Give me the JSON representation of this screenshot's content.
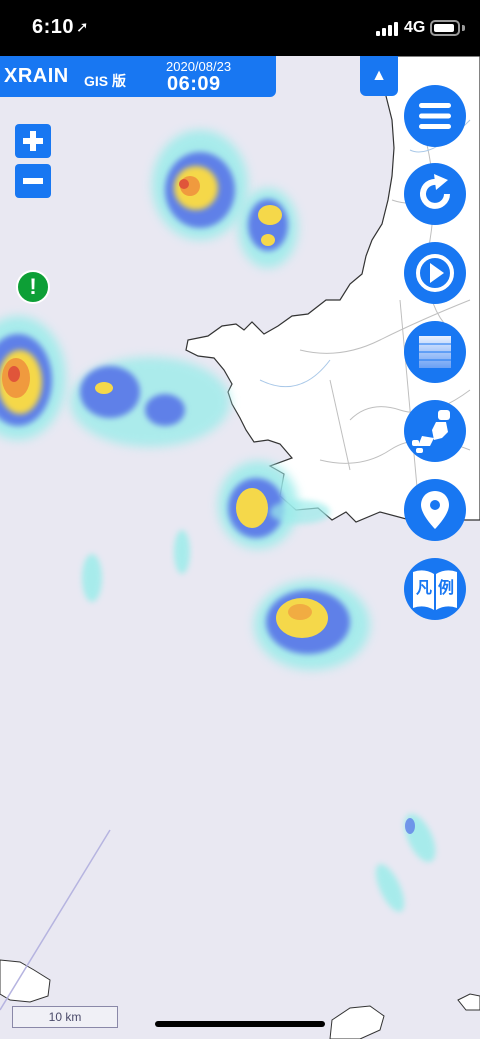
{
  "status_bar": {
    "time": "6:10",
    "location_icon": "location-arrow-icon",
    "network": "4G",
    "signal_icon": "cellular-signal-icon",
    "battery_icon": "battery-icon",
    "battery_level": 0.9
  },
  "header": {
    "title": "XRAIN",
    "subtitle": "GIS 版",
    "date": "2020/08/23",
    "time": "06:09"
  },
  "collapse_button": {
    "icon": "triangle-up-icon",
    "label": "▲"
  },
  "zoom": {
    "in_icon": "plus-icon",
    "out_icon": "minus-icon"
  },
  "alert": {
    "icon": "exclamation-icon",
    "label": "!",
    "color": "#0d9f36"
  },
  "side_buttons": [
    {
      "name": "menu-button",
      "icon": "hamburger-menu-icon"
    },
    {
      "name": "refresh-button",
      "icon": "refresh-icon"
    },
    {
      "name": "play-button",
      "icon": "play-icon"
    },
    {
      "name": "opacity-button",
      "icon": "layer-gradient-icon"
    },
    {
      "name": "japan-map-button",
      "icon": "japan-map-icon"
    },
    {
      "name": "current-location-button",
      "icon": "map-pin-icon"
    },
    {
      "name": "legend-button",
      "icon": "legend-book-icon"
    }
  ],
  "legend": {
    "char_left": "凡",
    "char_right": "例"
  },
  "scale": {
    "label": "10 km"
  },
  "colors": {
    "accent": "#1877f2",
    "sea": "#e9e8f2",
    "land": "#ffffff",
    "rain_light": "#9cecea",
    "rain_medium": "#5f80e8",
    "rain_heavy": "#f5d84a",
    "rain_intense": "#f09a3e",
    "rain_extreme": "#e0553a"
  }
}
